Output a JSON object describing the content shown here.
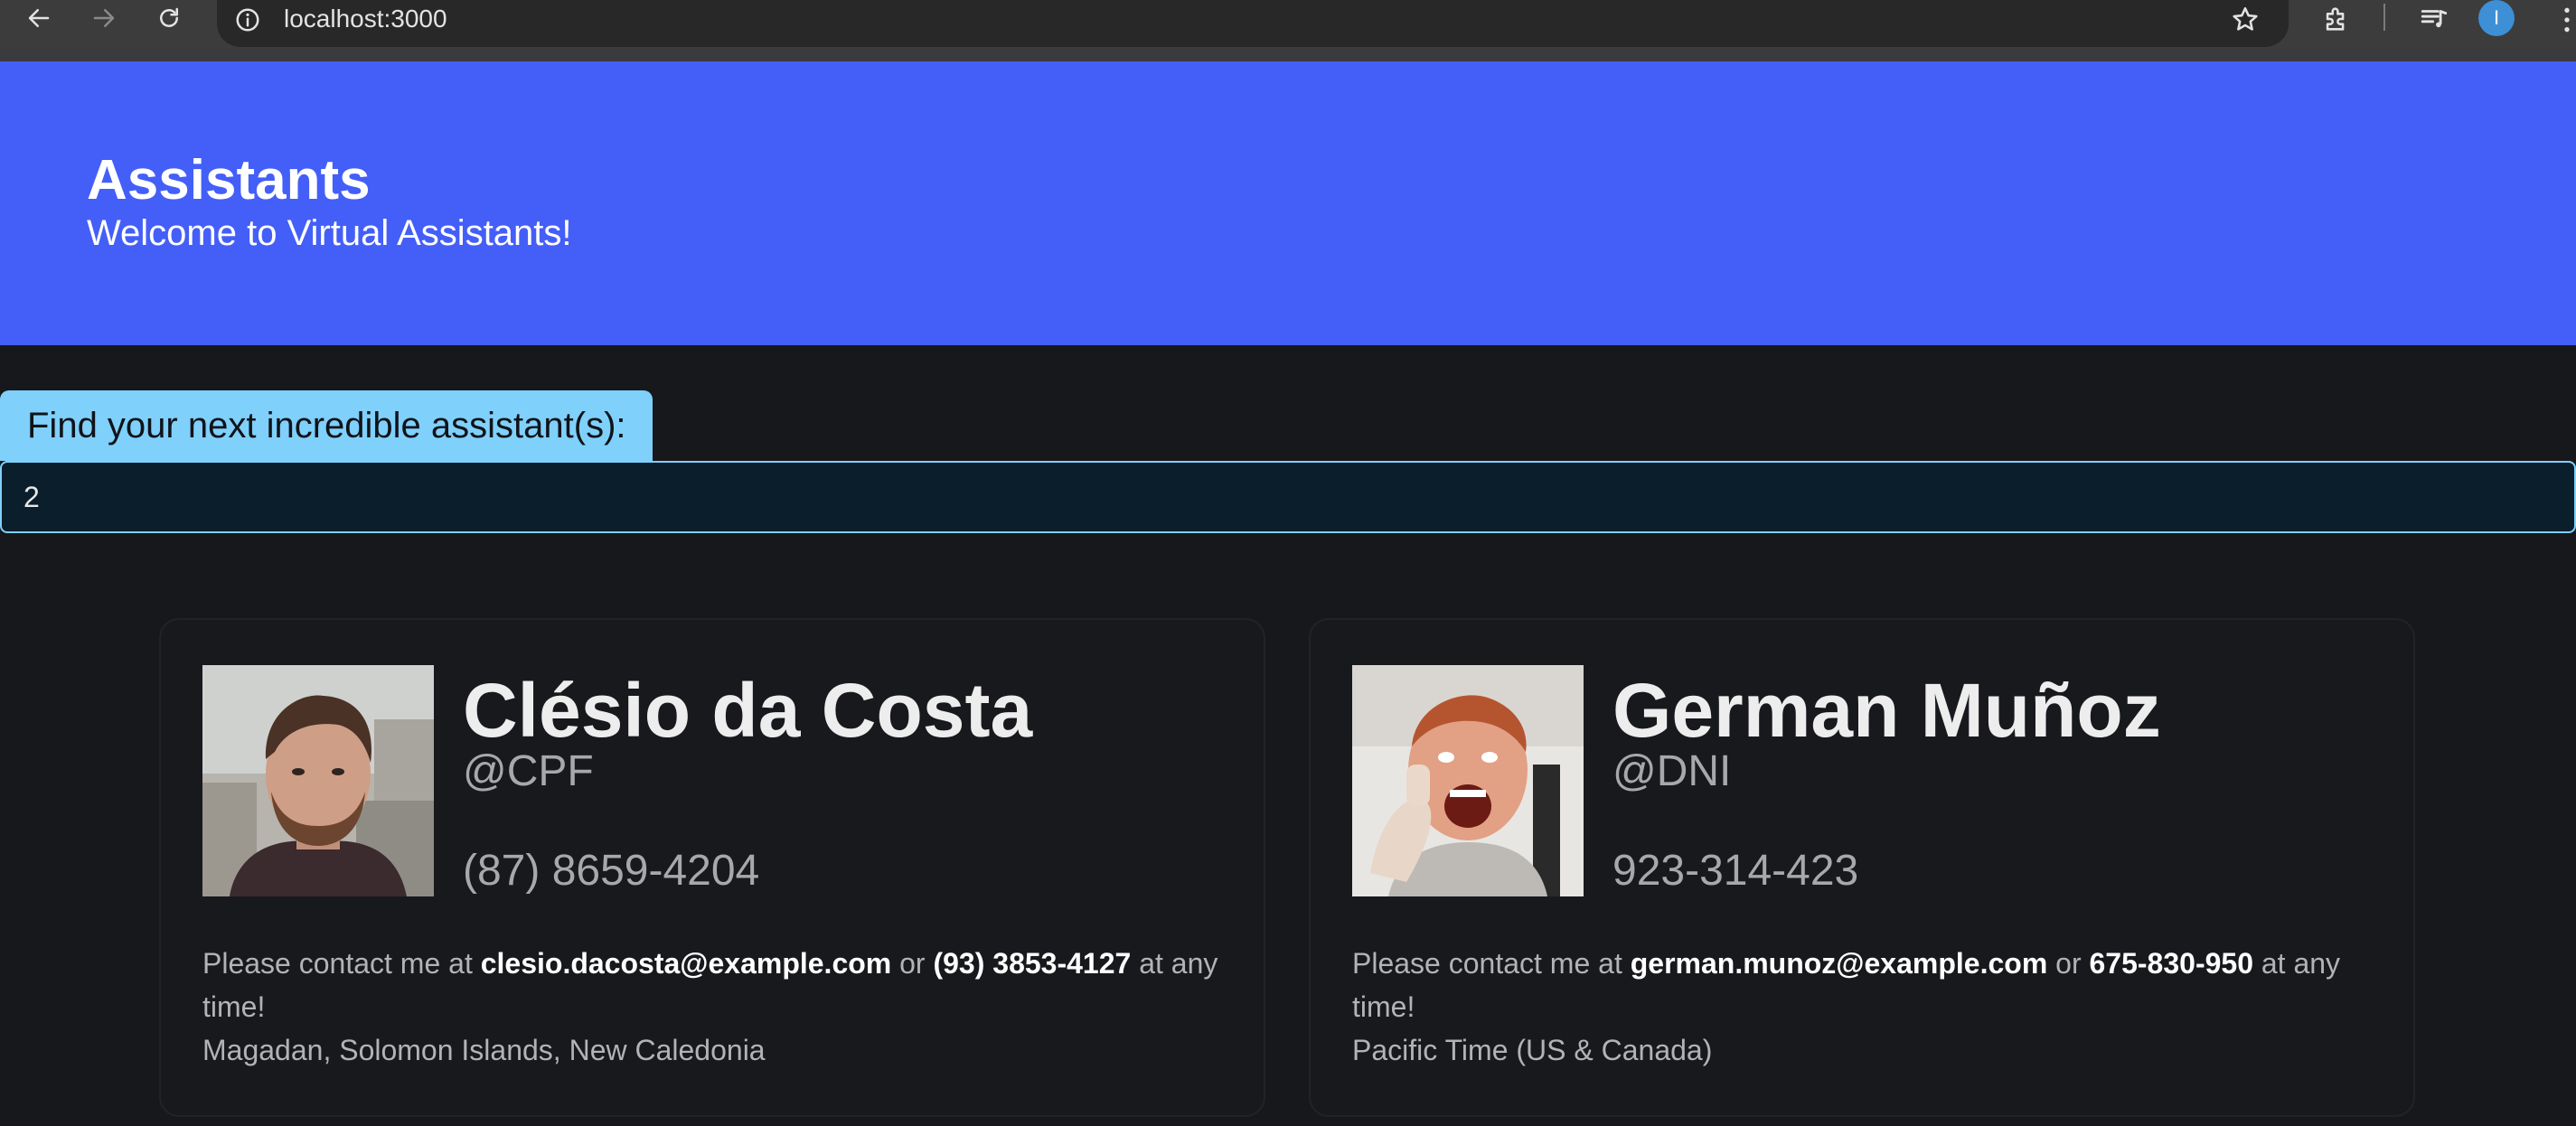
{
  "browser": {
    "url": "localhost:3000",
    "profile_initial": "I"
  },
  "header": {
    "title": "Assistants",
    "subtitle": "Welcome to Virtual Assistants!"
  },
  "search": {
    "label": "Find your next incredible assistant(s):",
    "value": "2"
  },
  "assistants": [
    {
      "name": "Clésio da Costa",
      "handle": "@CPF",
      "phone": "(87) 8659-4204",
      "contact_prefix": "Please contact me at",
      "email": "clesio.dacosta@example.com",
      "contact_or": "or",
      "alt_phone": "(93) 3853-4127",
      "contact_suffix": "at any time!",
      "location": "Magadan, Solomon Islands, New Caledonia"
    },
    {
      "name": "German Muñoz",
      "handle": "@DNI",
      "phone": "923-314-423",
      "contact_prefix": "Please contact me at",
      "email": "german.munoz@example.com",
      "contact_or": "or",
      "alt_phone": "675-830-950",
      "contact_suffix": "at any time!",
      "location": "Pacific Time (US & Canada)"
    }
  ],
  "colors": {
    "header_bg": "#445ff8",
    "page_bg": "#17181c",
    "search_label_bg": "#7fd0fb",
    "search_input_bg": "#0b1e2c",
    "profile_avatar": "#3d8fd6"
  }
}
